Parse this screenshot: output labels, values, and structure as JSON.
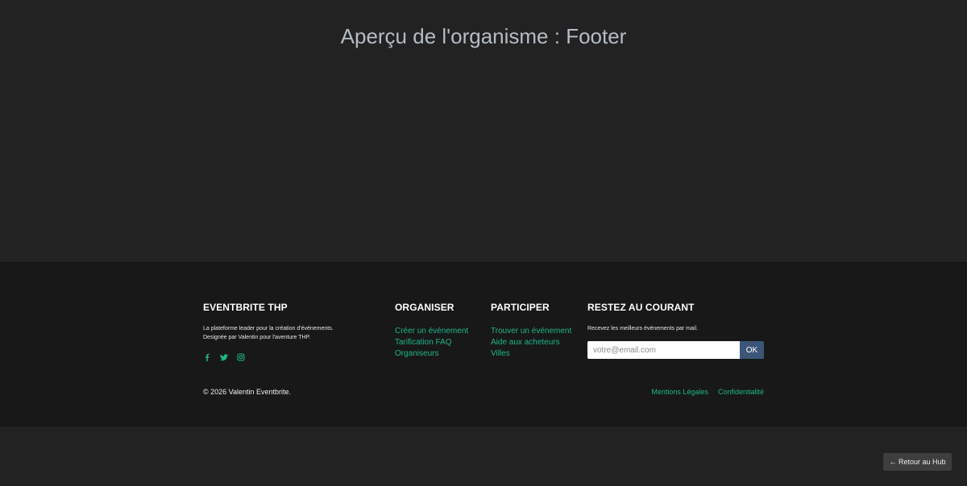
{
  "page": {
    "title": "Aperçu de l'organisme : Footer"
  },
  "footer": {
    "brand": {
      "title": "EVENTBRITE THP",
      "line1": "La plateforme leader pour la création d'événements.",
      "line2": "Designée par Valentin pour l'aventure THP.",
      "social": [
        "facebook-icon",
        "twitter-icon",
        "instagram-icon"
      ]
    },
    "organiser": {
      "title": "ORGANISER",
      "links": [
        "Créer un événement",
        "Tarification FAQ",
        "Organiseurs"
      ]
    },
    "participer": {
      "title": "PARTICIPER",
      "links": [
        "Trouver un événement",
        "Aide aux acheteurs",
        "Villes"
      ]
    },
    "newsletter": {
      "title": "RESTEZ AU COURANT",
      "text": "Recevez les meilleurs événements par mail.",
      "placeholder": "votre@email.com",
      "button": "OK"
    },
    "copyright": "© 2026 Valentin Eventbrite.",
    "bottom_links": [
      "Mentions Légales",
      "Confidentialité"
    ]
  },
  "hub_button": "← Retour au Hub",
  "colors": {
    "page_bg": "#222222",
    "footer_bg": "#181818",
    "link": "#20b58a",
    "button": "#3c5678"
  }
}
